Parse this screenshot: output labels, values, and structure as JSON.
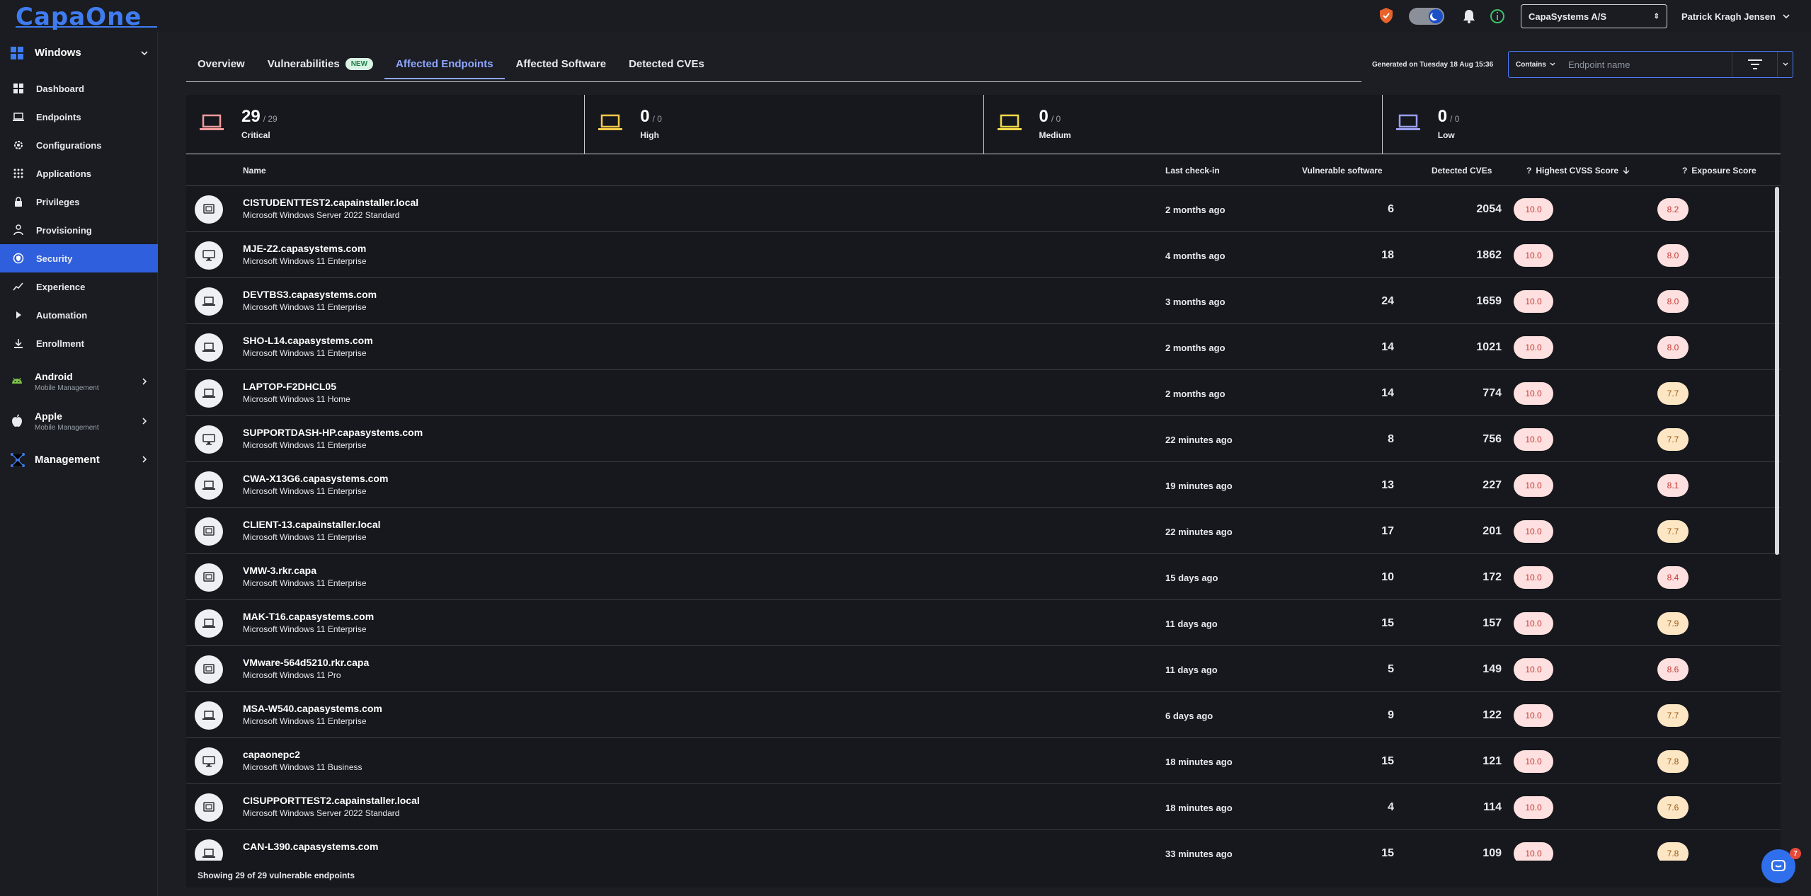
{
  "app": {
    "logo_text": "CapaOne"
  },
  "topbar": {
    "company_select": "CapaSystems A/S",
    "user_name": "Patrick Kragh Jensen"
  },
  "sidebar": {
    "windows": {
      "title": "Windows"
    },
    "items": [
      {
        "label": "Dashboard",
        "icon": "dashboard-icon"
      },
      {
        "label": "Endpoints",
        "icon": "laptop-icon"
      },
      {
        "label": "Configurations",
        "icon": "gear-icon"
      },
      {
        "label": "Applications",
        "icon": "apps-grid-icon"
      },
      {
        "label": "Privileges",
        "icon": "lock-icon"
      },
      {
        "label": "Provisioning",
        "icon": "user-tie-icon"
      },
      {
        "label": "Security",
        "icon": "shield-icon"
      },
      {
        "label": "Experience",
        "icon": "chart-line-icon"
      },
      {
        "label": "Automation",
        "icon": "play-icon"
      },
      {
        "label": "Enrollment",
        "icon": "download-icon"
      }
    ],
    "android": {
      "title": "Android",
      "subtitle": "Mobile Management"
    },
    "apple": {
      "title": "Apple",
      "subtitle": "Mobile Management"
    },
    "management": {
      "title": "Management"
    }
  },
  "tabs": [
    {
      "label": "Overview"
    },
    {
      "label": "Vulnerabilities",
      "badge": "NEW"
    },
    {
      "label": "Affected Endpoints"
    },
    {
      "label": "Affected Software"
    },
    {
      "label": "Detected CVEs"
    }
  ],
  "generated": "Generated on Tuesday 18 Aug 15:36",
  "search": {
    "mode": "Contains",
    "placeholder": "Endpoint name",
    "value": ""
  },
  "severity": [
    {
      "count": "29",
      "total": "/ 29",
      "label": "Critical",
      "color": "#f29b9b"
    },
    {
      "count": "0",
      "total": "/ 0",
      "label": "High",
      "color": "#f5c84a"
    },
    {
      "count": "0",
      "total": "/ 0",
      "label": "Medium",
      "color": "#f1d84a"
    },
    {
      "count": "0",
      "total": "/ 0",
      "label": "Low",
      "color": "#9a9ef0"
    }
  ],
  "table": {
    "headers": {
      "name": "Name",
      "checkin": "Last check-in",
      "vuln": "Vulnerable software",
      "cves": "Detected CVEs",
      "cvss": "Highest CVSS Score",
      "exposure": "Exposure Score"
    },
    "rows": [
      {
        "name": "CISTUDENTTEST2.capainstaller.local",
        "os": "Microsoft Windows Server 2022 Standard",
        "checkin": "2 months ago",
        "vuln": "6",
        "cves": "2054",
        "cvss": "10.0",
        "exposure": "8.2",
        "expo_level": "red",
        "icon": "server"
      },
      {
        "name": "MJE-Z2.capasystems.com",
        "os": "Microsoft Windows 11 Enterprise",
        "checkin": "4 months ago",
        "vuln": "18",
        "cves": "1862",
        "cvss": "10.0",
        "exposure": "8.0",
        "expo_level": "red",
        "icon": "desktop"
      },
      {
        "name": "DEVTBS3.capasystems.com",
        "os": "Microsoft Windows 11 Enterprise",
        "checkin": "3 months ago",
        "vuln": "24",
        "cves": "1659",
        "cvss": "10.0",
        "exposure": "8.0",
        "expo_level": "red",
        "icon": "laptop"
      },
      {
        "name": "SHO-L14.capasystems.com",
        "os": "Microsoft Windows 11 Enterprise",
        "checkin": "2 months ago",
        "vuln": "14",
        "cves": "1021",
        "cvss": "10.0",
        "exposure": "8.0",
        "expo_level": "red",
        "icon": "laptop"
      },
      {
        "name": "LAPTOP-F2DHCL05",
        "os": "Microsoft Windows 11 Home",
        "checkin": "2 months ago",
        "vuln": "14",
        "cves": "774",
        "cvss": "10.0",
        "exposure": "7.7",
        "expo_level": "amber",
        "icon": "laptop"
      },
      {
        "name": "SUPPORTDASH-HP.capasystems.com",
        "os": "Microsoft Windows 11 Enterprise",
        "checkin": "22 minutes ago",
        "vuln": "8",
        "cves": "756",
        "cvss": "10.0",
        "exposure": "7.7",
        "expo_level": "amber",
        "icon": "desktop"
      },
      {
        "name": "CWA-X13G6.capasystems.com",
        "os": "Microsoft Windows 11 Enterprise",
        "checkin": "19 minutes ago",
        "vuln": "13",
        "cves": "227",
        "cvss": "10.0",
        "exposure": "8.1",
        "expo_level": "red",
        "icon": "laptop"
      },
      {
        "name": "CLIENT-13.capainstaller.local",
        "os": "Microsoft Windows 11 Enterprise",
        "checkin": "22 minutes ago",
        "vuln": "17",
        "cves": "201",
        "cvss": "10.0",
        "exposure": "7.7",
        "expo_level": "amber",
        "icon": "server"
      },
      {
        "name": "VMW-3.rkr.capa",
        "os": "Microsoft Windows 11 Enterprise",
        "checkin": "15 days ago",
        "vuln": "10",
        "cves": "172",
        "cvss": "10.0",
        "exposure": "8.4",
        "expo_level": "red",
        "icon": "server"
      },
      {
        "name": "MAK-T16.capasystems.com",
        "os": "Microsoft Windows 11 Enterprise",
        "checkin": "11 days ago",
        "vuln": "15",
        "cves": "157",
        "cvss": "10.0",
        "exposure": "7.9",
        "expo_level": "amber",
        "icon": "laptop"
      },
      {
        "name": "VMware-564d5210.rkr.capa",
        "os": "Microsoft Windows 11 Pro",
        "checkin": "11 days ago",
        "vuln": "5",
        "cves": "149",
        "cvss": "10.0",
        "exposure": "8.6",
        "expo_level": "red",
        "icon": "server"
      },
      {
        "name": "MSA-W540.capasystems.com",
        "os": "Microsoft Windows 11 Enterprise",
        "checkin": "6 days ago",
        "vuln": "9",
        "cves": "122",
        "cvss": "10.0",
        "exposure": "7.7",
        "expo_level": "amber",
        "icon": "laptop"
      },
      {
        "name": "capaonepc2",
        "os": "Microsoft Windows 11 Business",
        "checkin": "18 minutes ago",
        "vuln": "15",
        "cves": "121",
        "cvss": "10.0",
        "exposure": "7.8",
        "expo_level": "amber",
        "icon": "desktop"
      },
      {
        "name": "CISUPPORTTEST2.capainstaller.local",
        "os": "Microsoft Windows Server 2022 Standard",
        "checkin": "18 minutes ago",
        "vuln": "4",
        "cves": "114",
        "cvss": "10.0",
        "exposure": "7.6",
        "expo_level": "amber",
        "icon": "server"
      },
      {
        "name": "CAN-L390.capasystems.com",
        "os": "",
        "checkin": "33 minutes ago",
        "vuln": "15",
        "cves": "109",
        "cvss": "10.0",
        "exposure": "7.8",
        "expo_level": "amber",
        "icon": "laptop"
      }
    ]
  },
  "footer": "Showing 29 of 29 vulnerable endpoints",
  "chat": {
    "badge": "7"
  }
}
